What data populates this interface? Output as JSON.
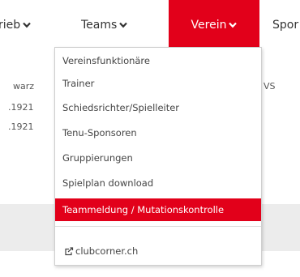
{
  "nav": {
    "items": [
      {
        "label": "rieb",
        "active": false
      },
      {
        "label": "Teams",
        "active": false
      },
      {
        "label": "Verein",
        "active": true
      },
      {
        "label": "Spor",
        "active": false
      }
    ]
  },
  "background": {
    "left_lines": [
      "warz",
      ".1921",
      ".1921"
    ],
    "right_text": "VS"
  },
  "dropdown": {
    "items": [
      "Vereinsfunktionäre",
      "Trainer",
      "Schiedsrichter/Spielleiter",
      "Tenu-Sponsoren",
      "Gruppierungen",
      "Spielplan download",
      "Teammeldung / Mutationskontrolle"
    ],
    "highlighted_index": 6,
    "external_link": {
      "label": "clubcorner.ch",
      "icon": "external-link-icon"
    }
  },
  "colors": {
    "accent": "#e2001a"
  }
}
